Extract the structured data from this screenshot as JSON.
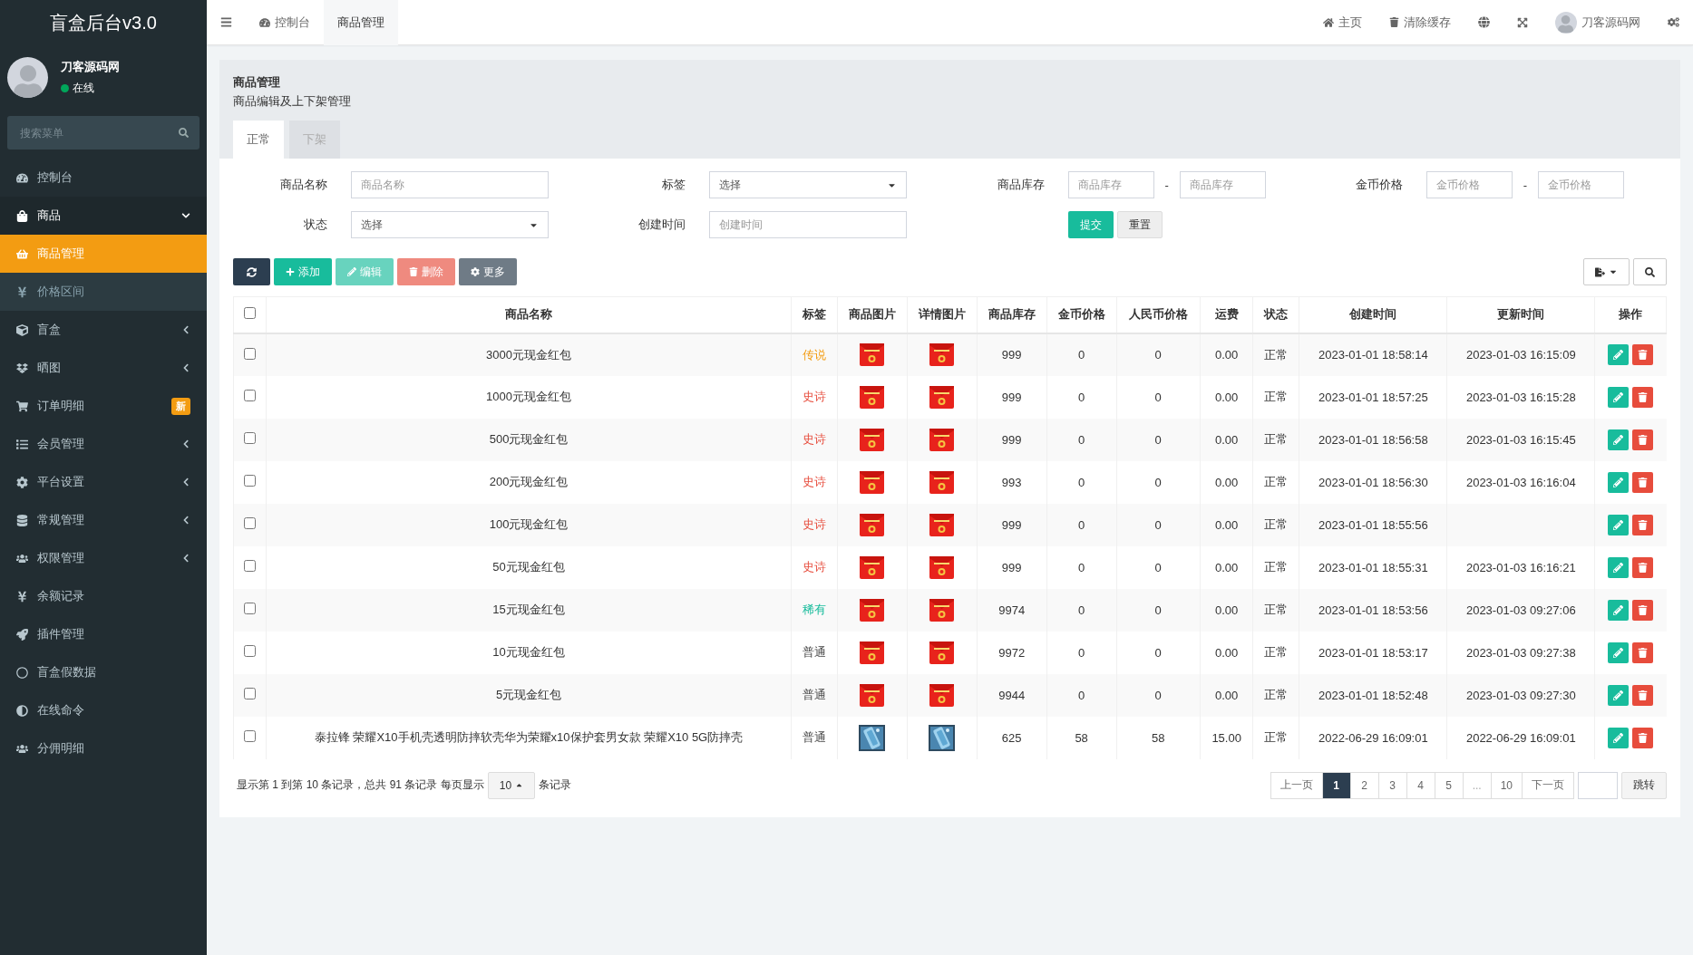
{
  "app": {
    "title": "盲盒后台v3.0"
  },
  "user": {
    "name": "刀客源码网",
    "status": "在线",
    "online": true
  },
  "sidebar": {
    "search": {
      "placeholder": "搜索菜单"
    },
    "items": [
      {
        "label": "控制台",
        "selected": false
      },
      {
        "label": "商品",
        "selected": false,
        "expanded": true,
        "children": [
          {
            "label": "商品管理",
            "selected": true
          },
          {
            "label": "价格区间",
            "selected": false
          }
        ]
      },
      {
        "label": "盲盒",
        "selected": false,
        "expanded": false
      },
      {
        "label": "晒图",
        "selected": false,
        "expanded": false
      },
      {
        "label": "订单明细",
        "selected": false,
        "badge": "新"
      },
      {
        "label": "会员管理",
        "selected": false,
        "expanded": false
      },
      {
        "label": "平台设置",
        "selected": false,
        "expanded": false
      },
      {
        "label": "常规管理",
        "selected": false,
        "expanded": false
      },
      {
        "label": "权限管理",
        "selected": false,
        "expanded": false
      },
      {
        "label": "余额记录",
        "selected": false
      },
      {
        "label": "插件管理",
        "selected": false
      },
      {
        "label": "盲盒假数据",
        "selected": false
      },
      {
        "label": "在线命令",
        "selected": false
      },
      {
        "label": "分佣明细",
        "selected": false
      }
    ]
  },
  "topbar": {
    "tabs": [
      {
        "label": "控制台",
        "selected": false
      },
      {
        "label": "商品管理",
        "selected": true
      }
    ],
    "links": [
      "主页",
      "清除缓存"
    ],
    "user": "刀客源码网"
  },
  "page": {
    "title": "商品管理",
    "subtitle": "商品编辑及上下架管理",
    "tabs": [
      {
        "label": "正常",
        "selected": true
      },
      {
        "label": "下架",
        "selected": false
      }
    ]
  },
  "filters": [
    {
      "kind": "text",
      "label": "商品名称",
      "placeholder": "商品名称"
    },
    {
      "kind": "select",
      "label": "标签",
      "value": "选择"
    },
    {
      "kind": "range",
      "label": "商品库存",
      "separator": "-",
      "placeholders": [
        "商品库存",
        "商品库存"
      ]
    },
    {
      "kind": "range",
      "label": "金币价格",
      "separator": "-",
      "placeholders": [
        "金币价格",
        "金币价格"
      ]
    },
    {
      "kind": "select",
      "label": "状态",
      "value": "选择"
    },
    {
      "kind": "text",
      "label": "创建时间",
      "placeholder": "创建时间"
    },
    {
      "kind": "buttons",
      "buttons": [
        "提交",
        "重置"
      ]
    }
  ],
  "toolbar": [
    {
      "kind": "refresh",
      "disabled": false
    },
    {
      "kind": "add",
      "label": "添加",
      "disabled": false
    },
    {
      "kind": "edit",
      "label": "编辑",
      "disabled": true
    },
    {
      "kind": "delete",
      "label": "删除",
      "disabled": true
    },
    {
      "kind": "more",
      "label": "更多",
      "disabled": false
    }
  ],
  "table": {
    "select_all": {
      "checked": false
    },
    "columns": [
      "商品名称",
      "标签",
      "商品图片",
      "详情图片",
      "商品库存",
      "金币价格",
      "人民币价格",
      "运费",
      "状态",
      "创建时间",
      "更新时间",
      "操作"
    ],
    "rows": [
      {
        "checked": false,
        "name": "3000元现金红包",
        "tag": "传说",
        "color": "#f39c12",
        "kind": "envelope",
        "stock": "999",
        "coin_price": "0",
        "rmb_price": "0",
        "shipping": "0.00",
        "status": "正常",
        "created": "2023-01-01 18:58:14",
        "updated": "2023-01-03 16:15:09"
      },
      {
        "checked": false,
        "name": "1000元现金红包",
        "tag": "史诗",
        "color": "#e74c3c",
        "kind": "envelope",
        "stock": "999",
        "coin_price": "0",
        "rmb_price": "0",
        "shipping": "0.00",
        "status": "正常",
        "created": "2023-01-01 18:57:25",
        "updated": "2023-01-03 16:15:28"
      },
      {
        "checked": false,
        "name": "500元现金红包",
        "tag": "史诗",
        "color": "#e74c3c",
        "kind": "envelope",
        "stock": "999",
        "coin_price": "0",
        "rmb_price": "0",
        "shipping": "0.00",
        "status": "正常",
        "created": "2023-01-01 18:56:58",
        "updated": "2023-01-03 16:15:45"
      },
      {
        "checked": false,
        "name": "200元现金红包",
        "tag": "史诗",
        "color": "#e74c3c",
        "kind": "envelope",
        "stock": "993",
        "coin_price": "0",
        "rmb_price": "0",
        "shipping": "0.00",
        "status": "正常",
        "created": "2023-01-01 18:56:30",
        "updated": "2023-01-03 16:16:04"
      },
      {
        "checked": false,
        "name": "100元现金红包",
        "tag": "史诗",
        "color": "#e74c3c",
        "kind": "envelope",
        "stock": "999",
        "coin_price": "0",
        "rmb_price": "0",
        "shipping": "0.00",
        "status": "正常",
        "created": "2023-01-01 18:55:56"
      },
      {
        "checked": false,
        "name": "50元现金红包",
        "tag": "史诗",
        "color": "#e74c3c",
        "kind": "envelope",
        "stock": "999",
        "coin_price": "0",
        "rmb_price": "0",
        "shipping": "0.00",
        "status": "正常",
        "created": "2023-01-01 18:55:31",
        "updated": "2023-01-03 16:16:21"
      },
      {
        "checked": false,
        "name": "15元现金红包",
        "tag": "稀有",
        "color": "#18bc9c",
        "kind": "envelope",
        "stock": "9974",
        "coin_price": "0",
        "rmb_price": "0",
        "shipping": "0.00",
        "status": "正常",
        "created": "2023-01-01 18:53:56",
        "updated": "2023-01-03 09:27:06"
      },
      {
        "checked": false,
        "name": "10元现金红包",
        "tag": "普通",
        "color": "#444444",
        "kind": "envelope",
        "stock": "9972",
        "coin_price": "0",
        "rmb_price": "0",
        "shipping": "0.00",
        "status": "正常",
        "created": "2023-01-01 18:53:17",
        "updated": "2023-01-03 09:27:38"
      },
      {
        "checked": false,
        "name": "5元现金红包",
        "tag": "普通",
        "color": "#444444",
        "kind": "envelope",
        "stock": "9944",
        "coin_price": "0",
        "rmb_price": "0",
        "shipping": "0.00",
        "status": "正常",
        "created": "2023-01-01 18:52:48",
        "updated": "2023-01-03 09:27:30"
      },
      {
        "checked": false,
        "name": "泰拉锋 荣耀X10手机壳透明防摔软壳华为荣耀x10保护套男女款 荣耀X10 5G防摔壳",
        "tag": "普通",
        "color": "#444444",
        "kind": "phone",
        "stock": "625",
        "coin_price": "58",
        "rmb_price": "58",
        "shipping": "15.00",
        "status": "正常",
        "created": "2022-06-29 16:09:01",
        "updated": "2022-06-29 16:09:01"
      }
    ]
  },
  "pagination": {
    "info_before": "显示第 1 到第 10 条记录，总共 91 条记录 每页显示",
    "page_size": "10",
    "info_after": "条记录",
    "prev": "上一页",
    "next": "下一页",
    "go": "跳转",
    "pages": [
      {
        "label": "1",
        "selected": true
      },
      {
        "label": "2",
        "selected": false
      },
      {
        "label": "3",
        "selected": false
      },
      {
        "label": "4",
        "selected": false
      },
      {
        "label": "5",
        "selected": false
      },
      {
        "label": "...",
        "selected": false
      },
      {
        "label": "10",
        "selected": false
      }
    ]
  }
}
